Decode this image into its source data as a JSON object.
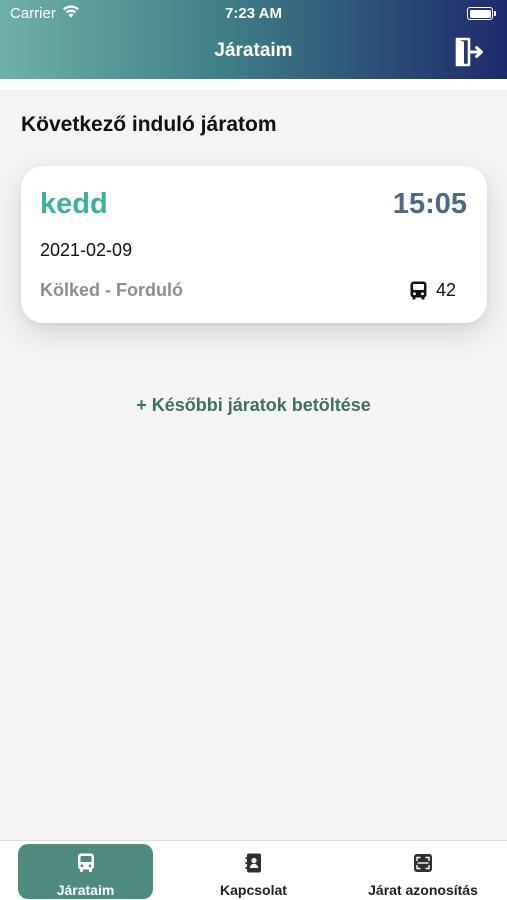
{
  "status_bar": {
    "carrier": "Carrier",
    "time": "7:23 AM"
  },
  "nav": {
    "title": "Járataim",
    "logout_icon": "logout-door-icon"
  },
  "section": {
    "title": "Következő induló járatom"
  },
  "trip": {
    "day": "kedd",
    "time": "15:05",
    "date": "2021-02-09",
    "route": "Kölked - Forduló",
    "bus_number": "42",
    "bus_icon": "bus-icon"
  },
  "load_more": {
    "label": "+ Későbbi járatok betöltése"
  },
  "tabs": [
    {
      "label": "Járataim",
      "icon": "bus-icon",
      "active": true
    },
    {
      "label": "Kapcsolat",
      "icon": "contacts-icon",
      "active": false
    },
    {
      "label": "Járat azonosítás",
      "icon": "qr-scan-icon",
      "active": false
    }
  ],
  "colors": {
    "accent": "#3db19b",
    "time": "#4d6a85",
    "active_tab": "#4e8b7e",
    "load_more": "#426e66"
  }
}
